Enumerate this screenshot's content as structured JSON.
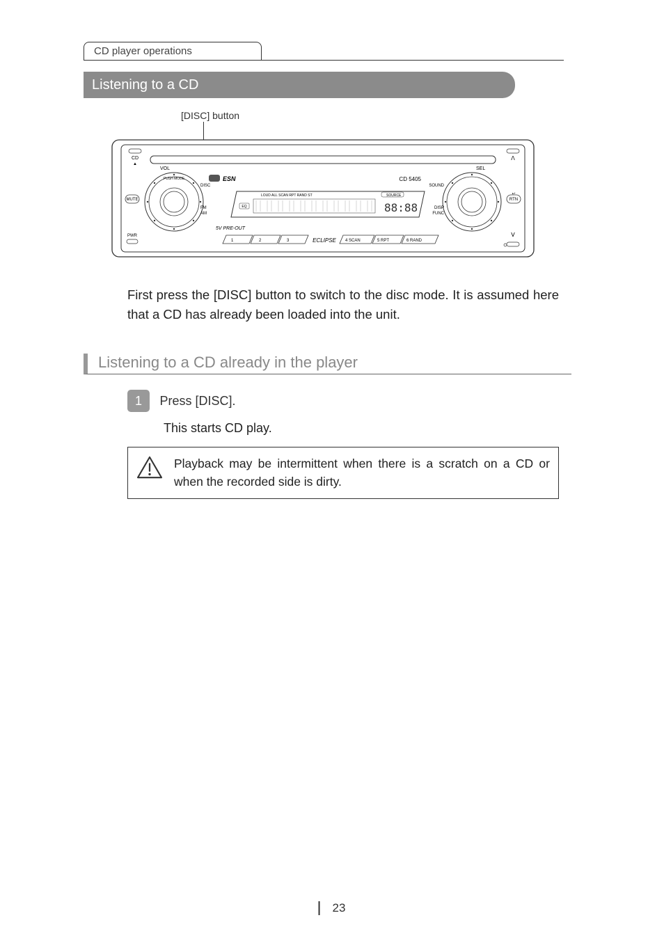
{
  "tab": "CD player operations",
  "title_bar": "Listening to a CD",
  "callout": "[DISC] button",
  "intro": "First press the [DISC] button to switch to the disc mode.  It is assumed here that a CD has already been loaded into the unit.",
  "section_heading": "Listening to a CD already in the player",
  "step": {
    "num": "1",
    "label": "Press [DISC].",
    "desc": "This starts CD play."
  },
  "caution": "Playback may be intermittent when there is a scratch on a CD or when the recorded side is dirty.",
  "page_number": "23",
  "device": {
    "cd_slot": "CD",
    "vol": "VOL",
    "sel": "SEL",
    "mute": "MUTE",
    "rtn": "RTN",
    "pwr": "PWR",
    "push_mode": "PUSH MODE",
    "sound": "SOUND",
    "disc": "DISC",
    "fm_am": "FM\nAM",
    "disp_func": "DISP\nFUNC",
    "esn": "ESN",
    "model": "CD 5405",
    "preout": "5V PRE-OUT",
    "brand": "ECLIPSE",
    "lcd_labels": "LOUD ALL SCAN RPT RAND ST",
    "source": "SOURCE",
    "eq": "EQ",
    "btn1": "1",
    "btn2": "2",
    "btn3": "3",
    "btn4": "4  SCAN",
    "btn5": "5  RPT",
    "btn6": "6  RAND",
    "up": "ᐱ",
    "down": "ᐯ",
    "ring_dot": "o"
  }
}
